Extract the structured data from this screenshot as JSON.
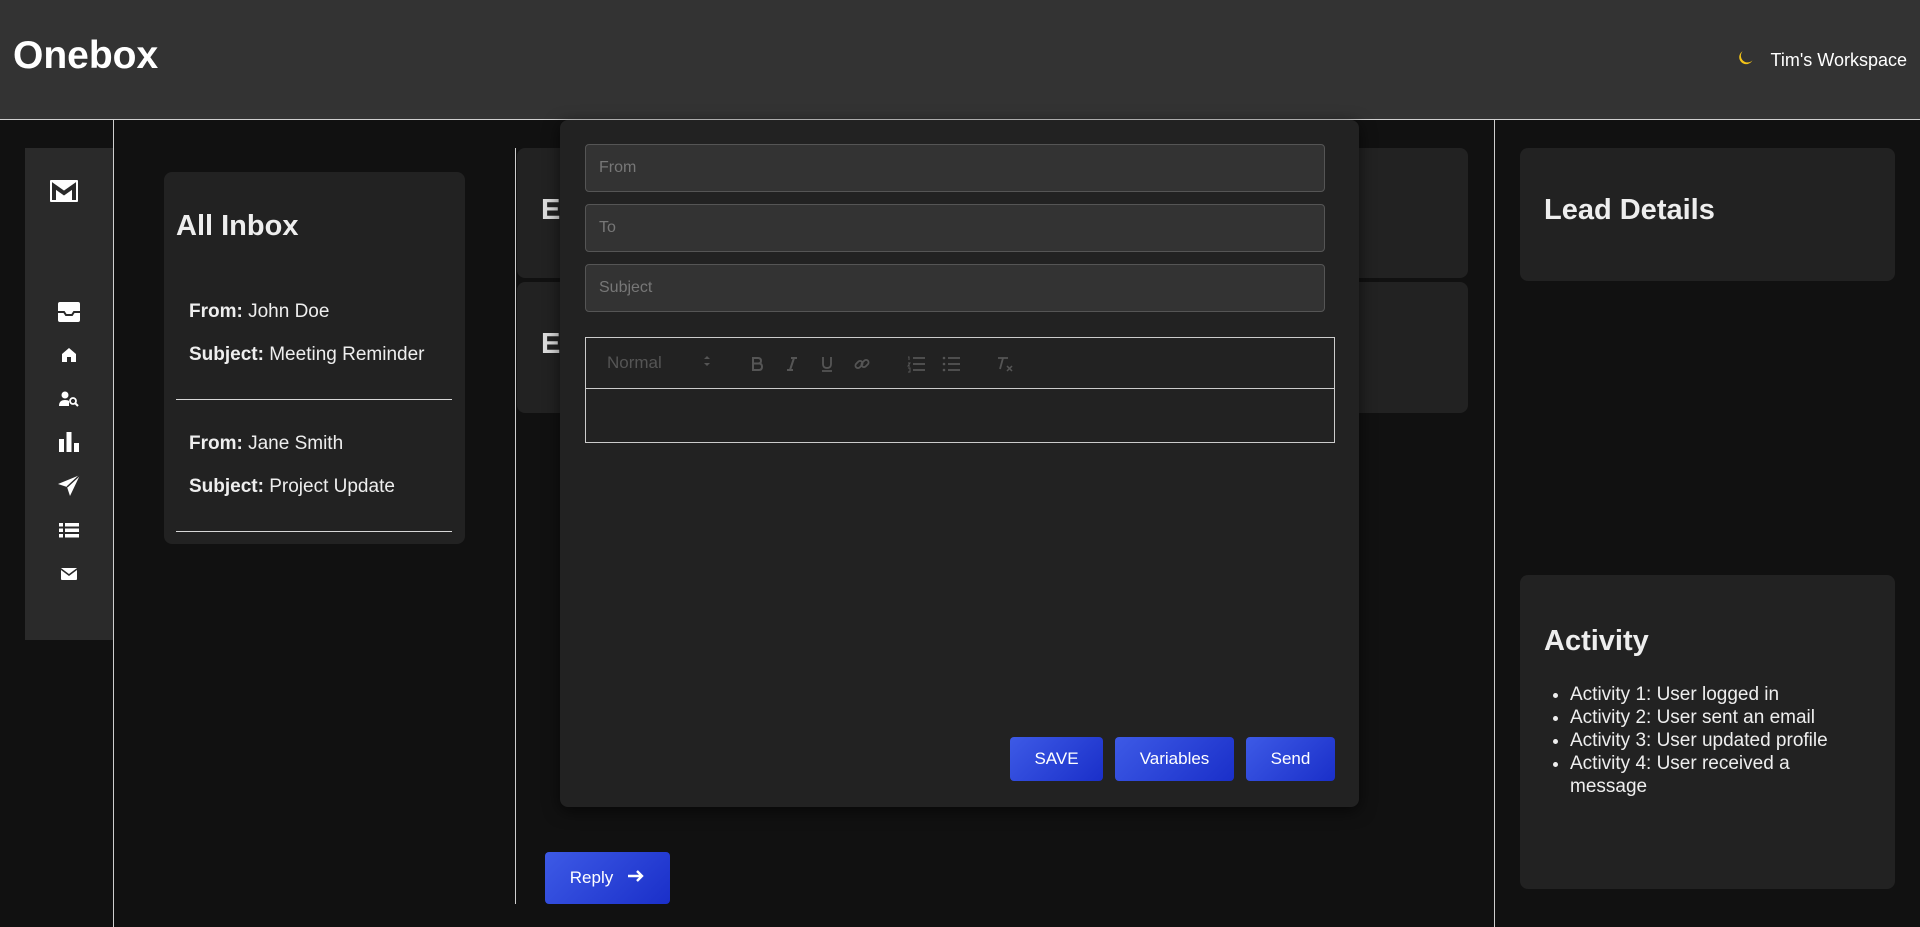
{
  "header": {
    "app_title": "Onebox",
    "theme_icon": "moon-icon",
    "workspace_label": "Tim's Workspace"
  },
  "sidebar": {
    "logo": "gmail-m-logo",
    "items": [
      {
        "name": "inbox-icon"
      },
      {
        "name": "home-icon"
      },
      {
        "name": "user-search-icon"
      },
      {
        "name": "bar-chart-icon"
      },
      {
        "name": "send-icon"
      },
      {
        "name": "list-icon"
      },
      {
        "name": "mail-icon"
      }
    ]
  },
  "inbox": {
    "title": "All Inbox",
    "from_label": "From:",
    "subject_label": "Subject:",
    "emails": [
      {
        "from": "John Doe",
        "subject": "Meeting Reminder"
      },
      {
        "from": "Jane Smith",
        "subject": "Project Update"
      }
    ]
  },
  "background_cards": {
    "card1_letter": "E",
    "card2_letter": "E"
  },
  "compose": {
    "from_placeholder": "From",
    "to_placeholder": "To",
    "subject_placeholder": "Subject",
    "format_select": "Normal",
    "toolbar": [
      "bold-icon",
      "italic-icon",
      "underline-icon",
      "link-icon",
      "ordered-list-icon",
      "bullet-list-icon",
      "clear-format-icon"
    ],
    "save_label": "SAVE",
    "variables_label": "Variables",
    "send_label": "Send"
  },
  "reply": {
    "label": "Reply"
  },
  "lead_details": {
    "title": "Lead Details"
  },
  "activity": {
    "title": "Activity",
    "items": [
      "Activity 1: User logged in",
      "Activity 2: User sent an email",
      "Activity 3: User updated profile",
      "Activity 4: User received a message"
    ]
  },
  "colors": {
    "header_bg": "#333333",
    "page_bg": "#111111",
    "panel_bg": "#222222",
    "accent": "#2b44d9",
    "moon": "#f5c518"
  }
}
